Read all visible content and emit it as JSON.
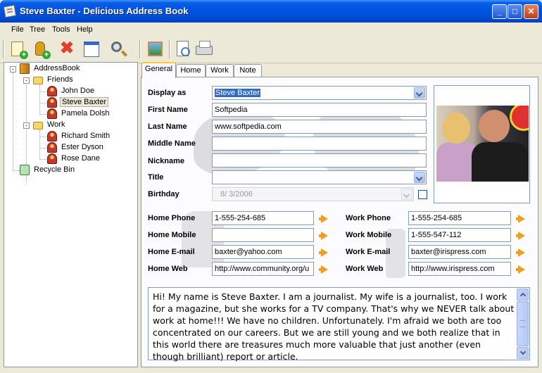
{
  "window": {
    "title": "Steve Baxter - Delicious Address Book"
  },
  "menu": [
    "File",
    "Tree",
    "Tools",
    "Help"
  ],
  "toolbar": {
    "buttons": [
      "new-contact-icon",
      "new-folder-icon",
      "delete-icon",
      "calendar-icon",
      "search-icon",
      "picture-icon",
      "print-preview-icon",
      "print-icon"
    ]
  },
  "tree": {
    "root": "AddressBook",
    "friends": "Friends",
    "john": "John Doe",
    "steve": "Steve Baxter",
    "pamela": "Pamela Dolsh",
    "work": "Work",
    "richard": "Richard Smith",
    "ester": "Ester Dyson",
    "rose": "Rose Dane",
    "recycle": "Recycle Bin"
  },
  "tabs": {
    "general": "General",
    "home": "Home",
    "work": "Work",
    "note": "Note"
  },
  "form": {
    "display_as_label": "Display as",
    "display_as_value": "Steve Baxter",
    "first_name_label": "First Name",
    "first_name_value": "Softpedia",
    "last_name_label": "Last Name",
    "last_name_value": "www.softpedia.com",
    "middle_name_label": "Middle Name",
    "middle_name_value": "",
    "nickname_label": "Nickname",
    "nickname_value": "",
    "title_label": "Title",
    "title_value": "",
    "birthday_label": "Birthday",
    "birthday_value": "8/  3/2006"
  },
  "contact": {
    "home_phone_label": "Home Phone",
    "home_phone_value": "1-555-254-685",
    "home_mobile_label": "Home Mobile",
    "home_mobile_value": "",
    "home_email_label": "Home E-mail",
    "home_email_value": "baxter@yahoo.com",
    "home_web_label": "Home Web",
    "home_web_value": "http://www.community.org/u",
    "work_phone_label": "Work Phone",
    "work_phone_value": "1-555-254-685",
    "work_mobile_label": "Work Mobile",
    "work_mobile_value": "1-555-547-112",
    "work_email_label": "Work E-mail",
    "work_email_value": "baxter@irispress.com",
    "work_web_label": "Work Web",
    "work_web_value": "http://www.irispress.com"
  },
  "notes": "Hi! My name is Steve Baxter. I am a journalist. My wife is a journalist, too. I work for a magazine, but she works for a TV company. That's why we NEVER talk about work at home!!! We have no children. Unfortunately. I'm afraid we both are too concentrated on our careers. But we are still young and we both realize that in this world there are treasures much more valuable that just another (even though brilliant) report or article."
}
